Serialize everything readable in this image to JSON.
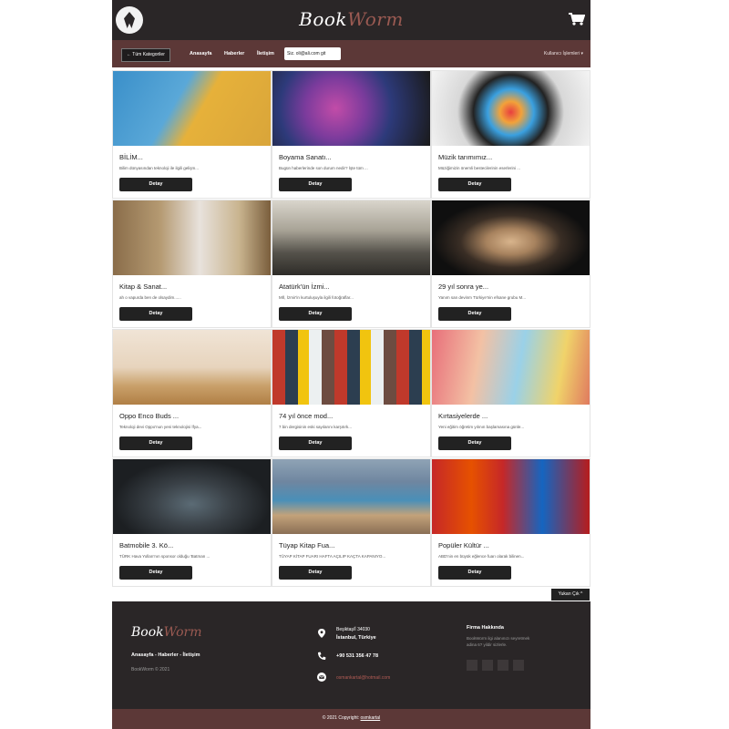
{
  "header": {
    "brand_part1": "Book",
    "brand_part2": "Worm"
  },
  "nav": {
    "categories_label": "← Tüm Kategoriler",
    "links": [
      "Anasayfa",
      "Haberler",
      "İletişim"
    ],
    "search_value": "Siz. oli@ali.com git",
    "user_label": "Kullanıcı İşlemleri ▾"
  },
  "cards": [
    {
      "title": "BİLİM...",
      "desc": "Bilim dünyasından teknoloji ile ilgili gelişm...",
      "button": "Detay"
    },
    {
      "title": "Boyama Sanatı...",
      "desc": "Bugün haberlerinde son durum nedir? İşte tüm ...",
      "button": "Detay"
    },
    {
      "title": "Müzik tarımımız...",
      "desc": "Müziğimizin önemli bestecilerinin eserlerini ...",
      "button": "Detay"
    },
    {
      "title": "Kitap & Sanat...",
      "desc": "ah o vapurda ben de olsaydim......",
      "button": "Detay"
    },
    {
      "title": "Atatürk'ün İzmi...",
      "desc": "Mİİ, İzmir'in kurtuluşuyla ilgili fotoğraflar...",
      "button": "Detay"
    },
    {
      "title": "29 yıl sonra ye...",
      "desc": "Yanım san devinm Türkiye'nin efsane grubu M...",
      "button": "Detay"
    },
    {
      "title": "Oppo Enco Buds ...",
      "desc": "Teknoloji devi Oppo'nun yeni teknolojisi İfya...",
      "button": "Detay"
    },
    {
      "title": "74 yıl önce mod...",
      "desc": "7 bin dergisinin eski sayılarını karşıtırk...",
      "button": "Detay"
    },
    {
      "title": "Kırtasiyelerde ...",
      "desc": "Yeni eğitim öğretim yılının başlamasına günle...",
      "button": "Detay"
    },
    {
      "title": "Batmobile 3. Kö...",
      "desc": "TÜRK Hava Yolları'nın sponsor olduğu 'Batman ...",
      "button": "Detay"
    },
    {
      "title": "Tüyap Kitap Fua...",
      "desc": "TÜYAP KİTAP FUARI HAFTA AÇILIP KAÇTA KAPANIYO...",
      "button": "Detay"
    },
    {
      "title": "Popüler Kültür ...",
      "desc": "ABD'nin en büyük eğlence fuarı olarak bilinen...",
      "button": "Detay"
    }
  ],
  "to_top": "Yukarı Çık ^",
  "footer": {
    "brand_part1": "Book",
    "brand_part2": "Worm",
    "links": "Anasayfa - Haberler - İletişim",
    "copyright": "BookWorm © 2021",
    "address_line1": "Beşiktaş/İ 34030",
    "address_line2": "İstanbul, Türkiye",
    "phone": "+90 531 356 47 78",
    "email": "osmankartal@hotmail.com",
    "about_title": "Firma Hakkında",
    "about_text": "BookWorm ilgi alanınızı seyretmek adina 6? yildir sizlerle.",
    "bottom_text": "© 2021 Copyright: ",
    "bottom_link": "osmkartal"
  },
  "colors": {
    "header_bg": "#2a2627",
    "nav_bg": "#5c3837",
    "accent": "#9b5a52"
  }
}
